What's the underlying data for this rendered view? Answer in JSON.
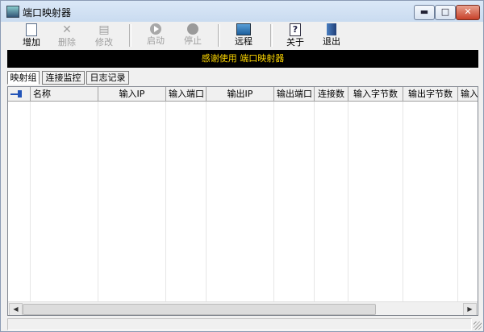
{
  "window": {
    "title": "端口映射器",
    "min": "▬",
    "max": "□",
    "close": "✕"
  },
  "toolbar": {
    "add": "增加",
    "delete": "删除",
    "edit": "修改",
    "start": "启动",
    "stop": "停止",
    "remote": "远程",
    "about": "关于",
    "exit": "退出"
  },
  "icons": {
    "delete_glyph": "✕",
    "edit_glyph": "▤",
    "help_glyph": "?"
  },
  "banner": {
    "text": "感谢使用 端口映射器",
    "color": "#ffd800"
  },
  "tabs": [
    "映射组",
    "连接监控",
    "日志记录"
  ],
  "table": {
    "columns": [
      "名称",
      "输入IP",
      "输入端口",
      "输出IP",
      "输出端口",
      "连接数",
      "输入字节数",
      "输出字节数",
      "输入"
    ],
    "rows": []
  },
  "scroll": {
    "left": "◀",
    "right": "▶"
  }
}
